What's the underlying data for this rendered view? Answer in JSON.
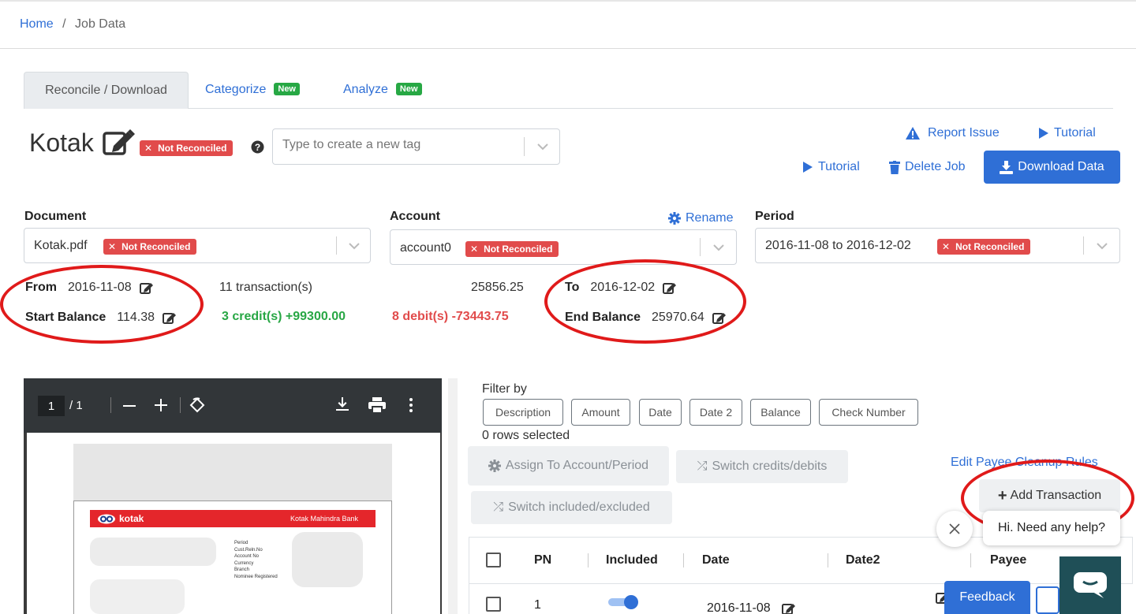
{
  "breadcrumb": {
    "home": "Home",
    "separator": "/",
    "current": "Job Data"
  },
  "tabs": [
    {
      "label": "Reconcile / Download",
      "active": true
    },
    {
      "label": "Categorize",
      "badge": "New"
    },
    {
      "label": "Analyze",
      "badge": "New"
    }
  ],
  "job": {
    "title": "Kotak",
    "status": "Not Reconciled",
    "tag_placeholder": "Type to create a new tag"
  },
  "actions": {
    "report_issue": "Report Issue",
    "tutorial_top": "Tutorial",
    "tutorial": "Tutorial",
    "delete_job": "Delete Job",
    "download_data": "Download Data"
  },
  "document": {
    "label": "Document",
    "value": "Kotak.pdf",
    "status": "Not Reconciled"
  },
  "account": {
    "label": "Account",
    "rename": "Rename",
    "value": "account0",
    "status": "Not Reconciled"
  },
  "period": {
    "label": "Period",
    "value": "2016-11-08 to 2016-12-02",
    "status": "Not Reconciled"
  },
  "summary": {
    "from_label": "From",
    "from_value": "2016-11-08",
    "start_balance_label": "Start Balance",
    "start_balance_value": "114.38",
    "transactions": "11 transaction(s)",
    "credits": "3 credit(s) +99300.00",
    "debits": "8 debit(s) -73443.75",
    "total": "25856.25",
    "to_label": "To",
    "to_value": "2016-12-02",
    "end_balance_label": "End Balance",
    "end_balance_value": "25970.64"
  },
  "pdf_viewer": {
    "page_current": "1",
    "page_total": "/ 1",
    "bank_name": "Kotak Mahindra Bank",
    "logo_text": "kotak",
    "meta_lines": [
      "Period",
      "Cust.Reln.No",
      "Account No",
      "Currency",
      "Branch",
      "Nominee Registered"
    ]
  },
  "filter": {
    "label": "Filter by",
    "buttons": [
      "Description",
      "Amount",
      "Date",
      "Date 2",
      "Balance",
      "Check Number"
    ],
    "rows_selected": "0 rows selected"
  },
  "bulk_actions": {
    "assign": "Assign To Account/Period",
    "switch_cd": "Switch credits/debits",
    "switch_ie": "Switch included/excluded",
    "edit_payee": "Edit Payee Cleanup Rules",
    "add_transaction": "Add Transaction"
  },
  "table": {
    "columns": [
      "PN",
      "Included",
      "Date",
      "Date2",
      "Payee"
    ],
    "rows": [
      {
        "pn": "1",
        "included": true,
        "date": "2016-11-08"
      }
    ]
  },
  "help_widget": {
    "message": "Hi. Need any help?",
    "feedback": "Feedback"
  },
  "colors": {
    "link": "#2f6fd6",
    "danger": "#e14b4b",
    "success": "#28a745",
    "annotation": "#e01a1a"
  }
}
